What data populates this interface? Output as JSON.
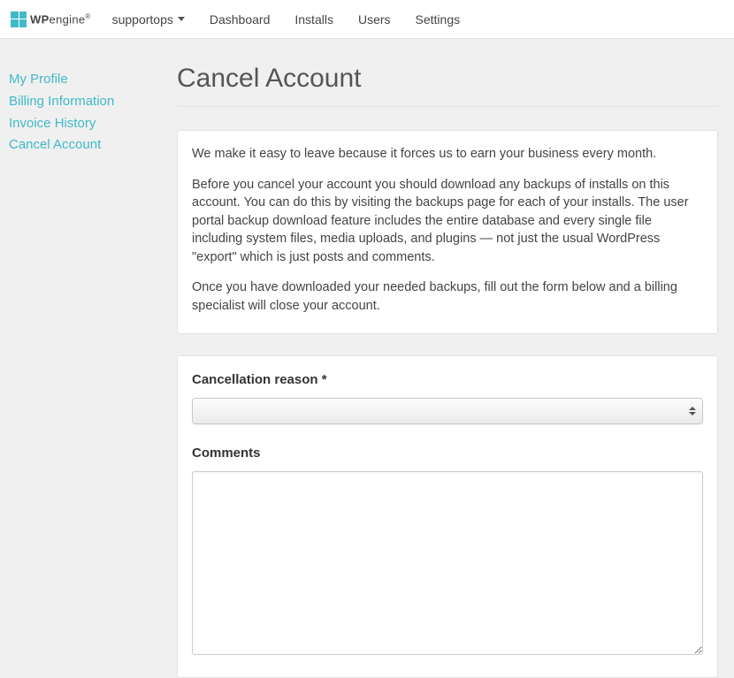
{
  "brand": {
    "name_light": "WP",
    "name_bold": "engine"
  },
  "nav": {
    "account": "supportops",
    "items": [
      "Dashboard",
      "Installs",
      "Users",
      "Settings"
    ]
  },
  "sidebar": {
    "items": [
      {
        "label": "My Profile"
      },
      {
        "label": "Billing Information"
      },
      {
        "label": "Invoice History"
      },
      {
        "label": "Cancel Account"
      }
    ]
  },
  "page": {
    "title": "Cancel Account",
    "intro": [
      "We make it easy to leave because it forces us to earn your business every month.",
      "Before you cancel your account you should download any backups of installs on this account. You can do this by visiting the backups page for each of your installs. The user portal backup download feature includes the entire database and every single file including system files, media uploads, and plugins — not just the usual WordPress \"export\" which is just posts and comments.",
      "Once you have downloaded your needed backups, fill out the form below and a billing specialist will close your account."
    ]
  },
  "form": {
    "reason_label": "Cancellation reason *",
    "reason_value": "",
    "comments_label": "Comments",
    "comments_value": ""
  }
}
